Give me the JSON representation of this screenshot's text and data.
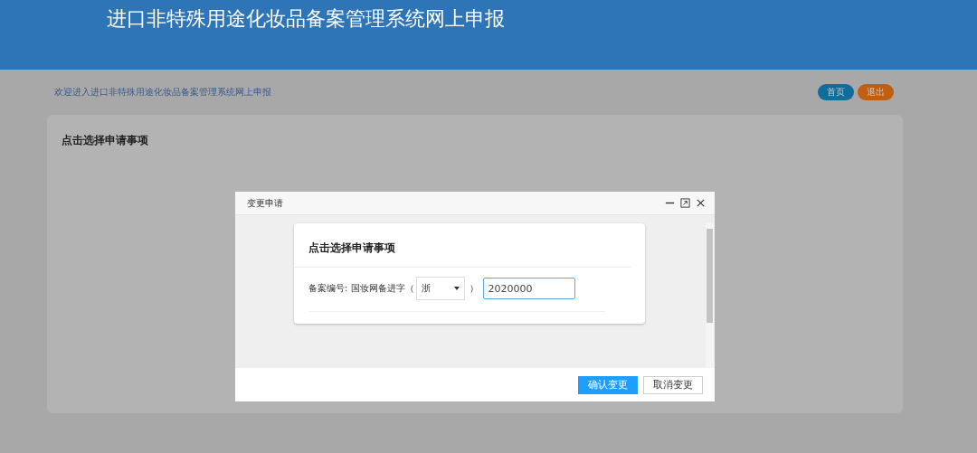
{
  "header": {
    "title": "进口非特殊用途化妆品备案管理系统网上申报"
  },
  "welcome": "欢迎进入进口非特殊用途化妆品备案管理系统网上申报",
  "nav_buttons": [
    {
      "label": "首页",
      "kind": "primary"
    },
    {
      "label": "退出",
      "kind": "warning"
    }
  ],
  "panel": {
    "title": "点击选择申请事项"
  },
  "dialog": {
    "title": "变更申请",
    "card": {
      "title": "点击选择申请事项",
      "field_label": "备案编号: 国妆网备进字（",
      "province": "浙",
      "close_paren": "）",
      "number": "2020000"
    },
    "buttons": [
      {
        "label": "确认变更",
        "kind": "primary"
      },
      {
        "label": "取消变更",
        "kind": "default"
      }
    ]
  }
}
